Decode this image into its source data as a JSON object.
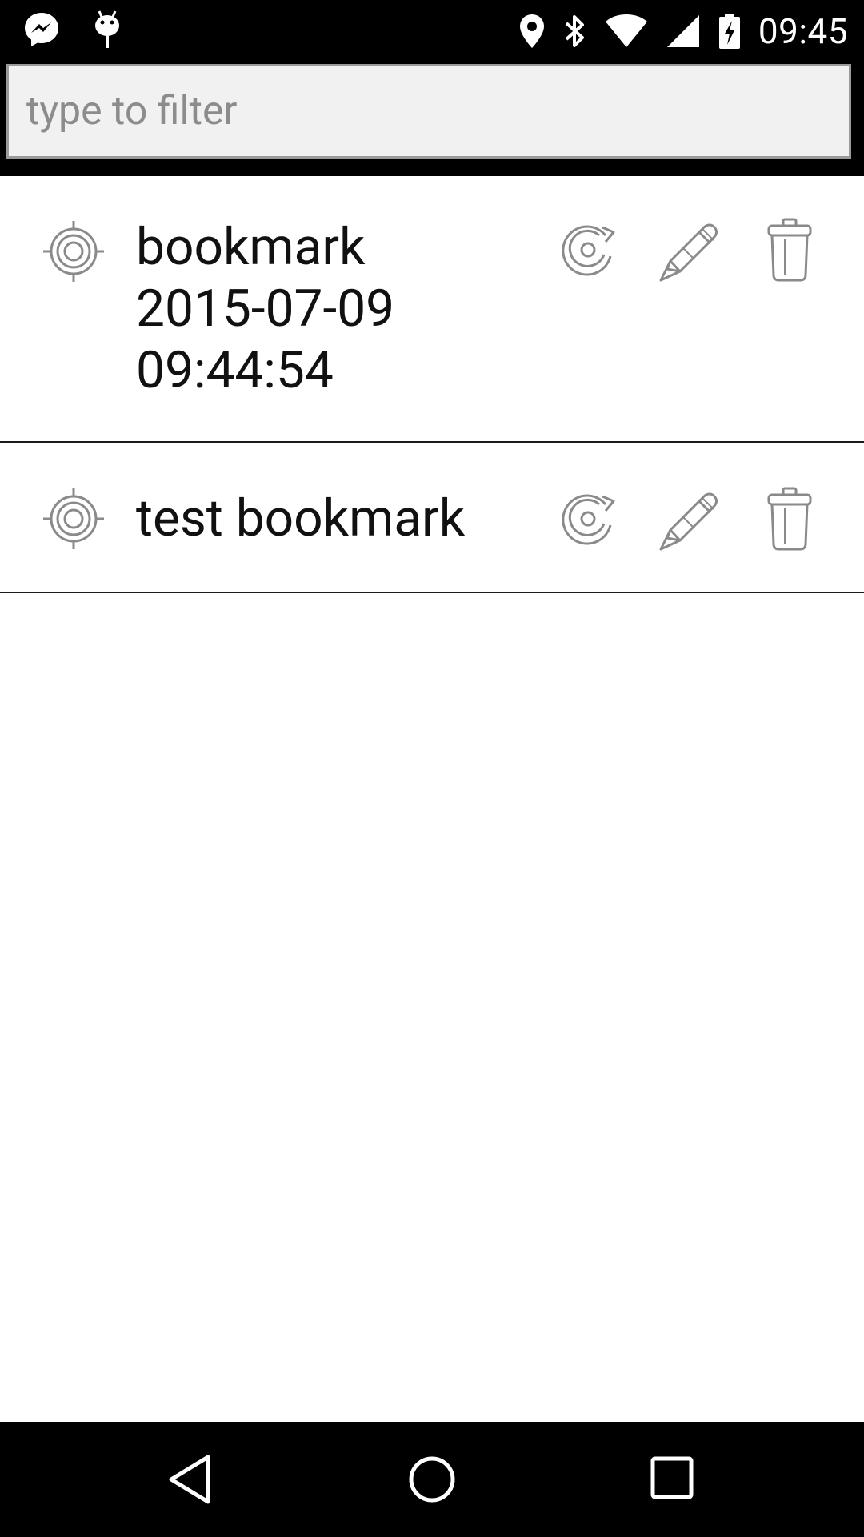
{
  "status_bar": {
    "time": "09:45",
    "left_icons": [
      "messenger-icon",
      "android-debug-icon"
    ],
    "right_icons": [
      "location-icon",
      "bluetooth-icon",
      "wifi-icon",
      "signal-icon",
      "battery-charging-icon"
    ]
  },
  "filter": {
    "placeholder": "type to filter",
    "value": ""
  },
  "bookmarks": [
    {
      "title": "bookmark\n2015-07-09\n09:44:54",
      "actions": [
        "refresh-icon",
        "edit-icon",
        "delete-icon"
      ]
    },
    {
      "title": "test bookmark",
      "actions": [
        "refresh-icon",
        "edit-icon",
        "delete-icon"
      ]
    }
  ],
  "nav_bar": {
    "buttons": [
      "back-icon",
      "home-icon",
      "recents-icon"
    ]
  },
  "colors": {
    "bars": "#000000",
    "icon_gray": "#8a8a8a",
    "text": "#111111"
  }
}
